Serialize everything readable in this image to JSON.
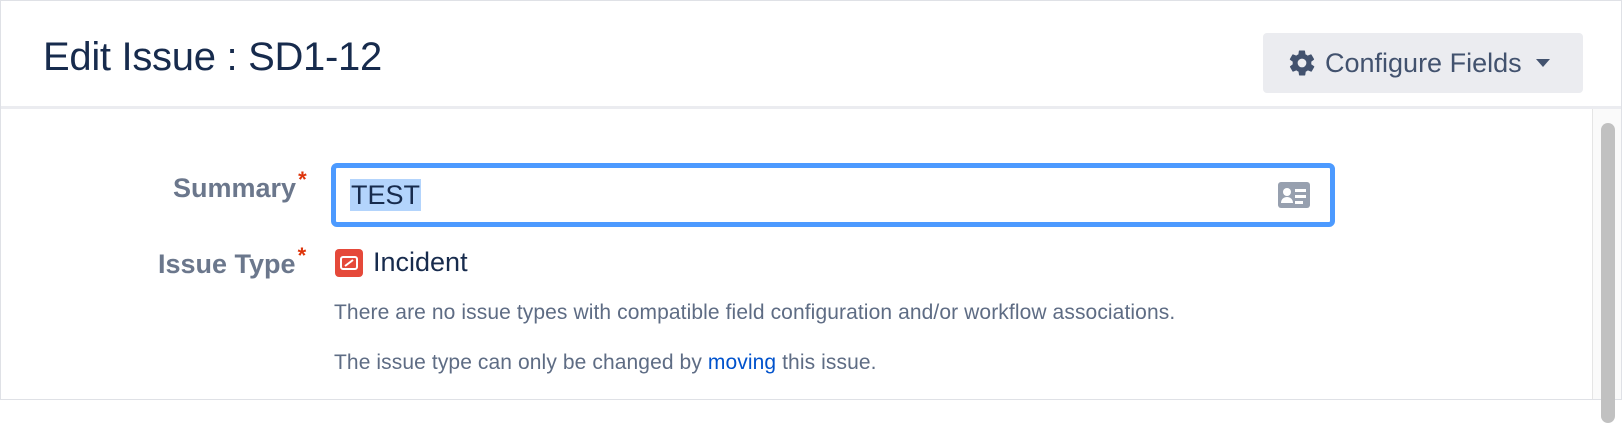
{
  "header": {
    "title": "Edit Issue : SD1-12",
    "configure_button": {
      "label": "Configure Fields",
      "icon": "gear-icon"
    }
  },
  "form": {
    "summary": {
      "label": "Summary",
      "required_marker": "*",
      "value": "TEST",
      "icon": "card-icon"
    },
    "issue_type": {
      "label": "Issue Type",
      "required_marker": "*",
      "value": "Incident",
      "icon": "incident-icon",
      "icon_color": "#e5493a",
      "note_1": "There are no issue types with compatible field configuration and/or workflow associations.",
      "note_2_prefix": "The issue type can only be changed by ",
      "note_2_link": "moving",
      "note_2_suffix": " this issue."
    }
  },
  "colors": {
    "focus_ring": "#4c9aff",
    "required": "#de350b",
    "link": "#0052cc",
    "label": "#6b778c"
  }
}
